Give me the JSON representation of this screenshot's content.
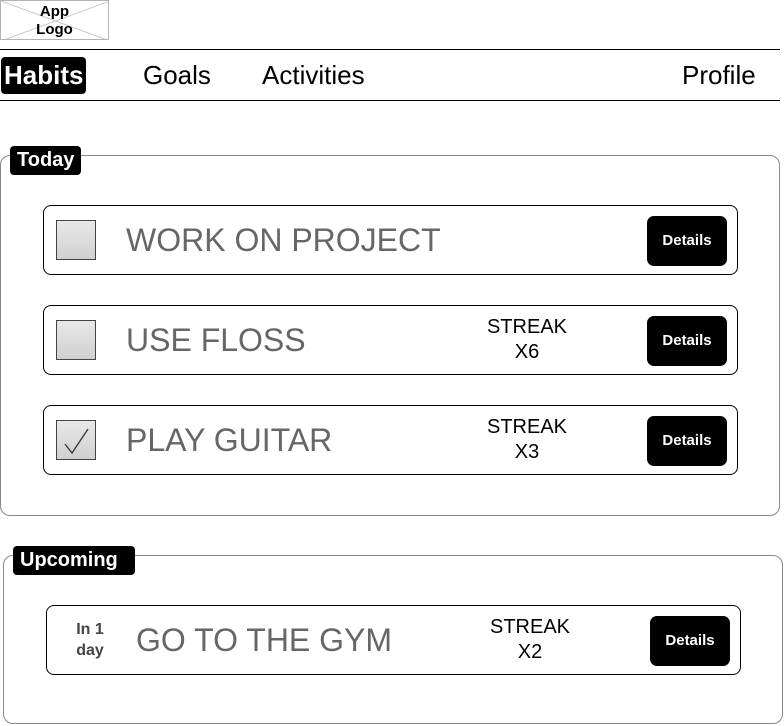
{
  "app": {
    "logo_text": "App\nLogo"
  },
  "nav": {
    "habits": "Habits",
    "goals": "Goals",
    "activities": "Activities",
    "profile": "Profile"
  },
  "today": {
    "label": "Today",
    "habits": [
      {
        "title": "WORK ON PROJECT",
        "checked": false,
        "streak_line1": "",
        "streak_line2": "",
        "details": "Details"
      },
      {
        "title": "USE FLOSS",
        "checked": false,
        "streak_line1": "STREAK",
        "streak_line2": "X6",
        "details": "Details"
      },
      {
        "title": "PLAY GUITAR",
        "checked": true,
        "streak_line1": "STREAK",
        "streak_line2": "X3",
        "details": "Details"
      }
    ]
  },
  "upcoming": {
    "label": "Upcoming",
    "habits": [
      {
        "due_line1": "In 1",
        "due_line2": "day",
        "title": "GO TO THE GYM",
        "streak_line1": "STREAK",
        "streak_line2": "X2",
        "details": "Details"
      }
    ]
  },
  "icons": {
    "checkmark": "check-icon",
    "logo_placeholder": "image-placeholder-icon"
  }
}
